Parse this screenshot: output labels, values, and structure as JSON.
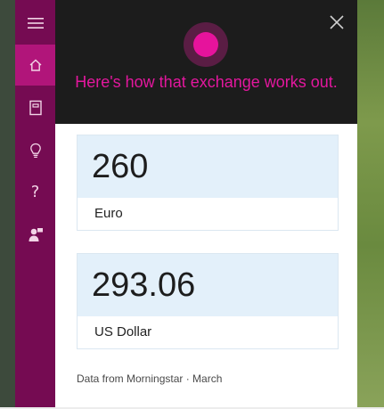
{
  "sidebar": {
    "items": [
      {
        "icon": "hamburger-menu-icon"
      },
      {
        "icon": "home-icon",
        "active": true
      },
      {
        "icon": "notebook-icon"
      },
      {
        "icon": "lightbulb-icon"
      },
      {
        "icon": "help-icon",
        "label": "?"
      },
      {
        "icon": "feedback-icon"
      }
    ]
  },
  "header": {
    "message": "Here's how that exchange works out."
  },
  "conversion": {
    "from": {
      "amount": "260",
      "currency": "Euro"
    },
    "to": {
      "amount": "293.06",
      "currency": "US Dollar"
    }
  },
  "footer": {
    "source": "Data from Morningstar · March"
  },
  "colors": {
    "sidebar": "#750b52",
    "sidebar_active": "#b1157a",
    "accent": "#e3179e",
    "header_bg": "#1c1c1c",
    "card_bg": "#e3f0fa"
  }
}
